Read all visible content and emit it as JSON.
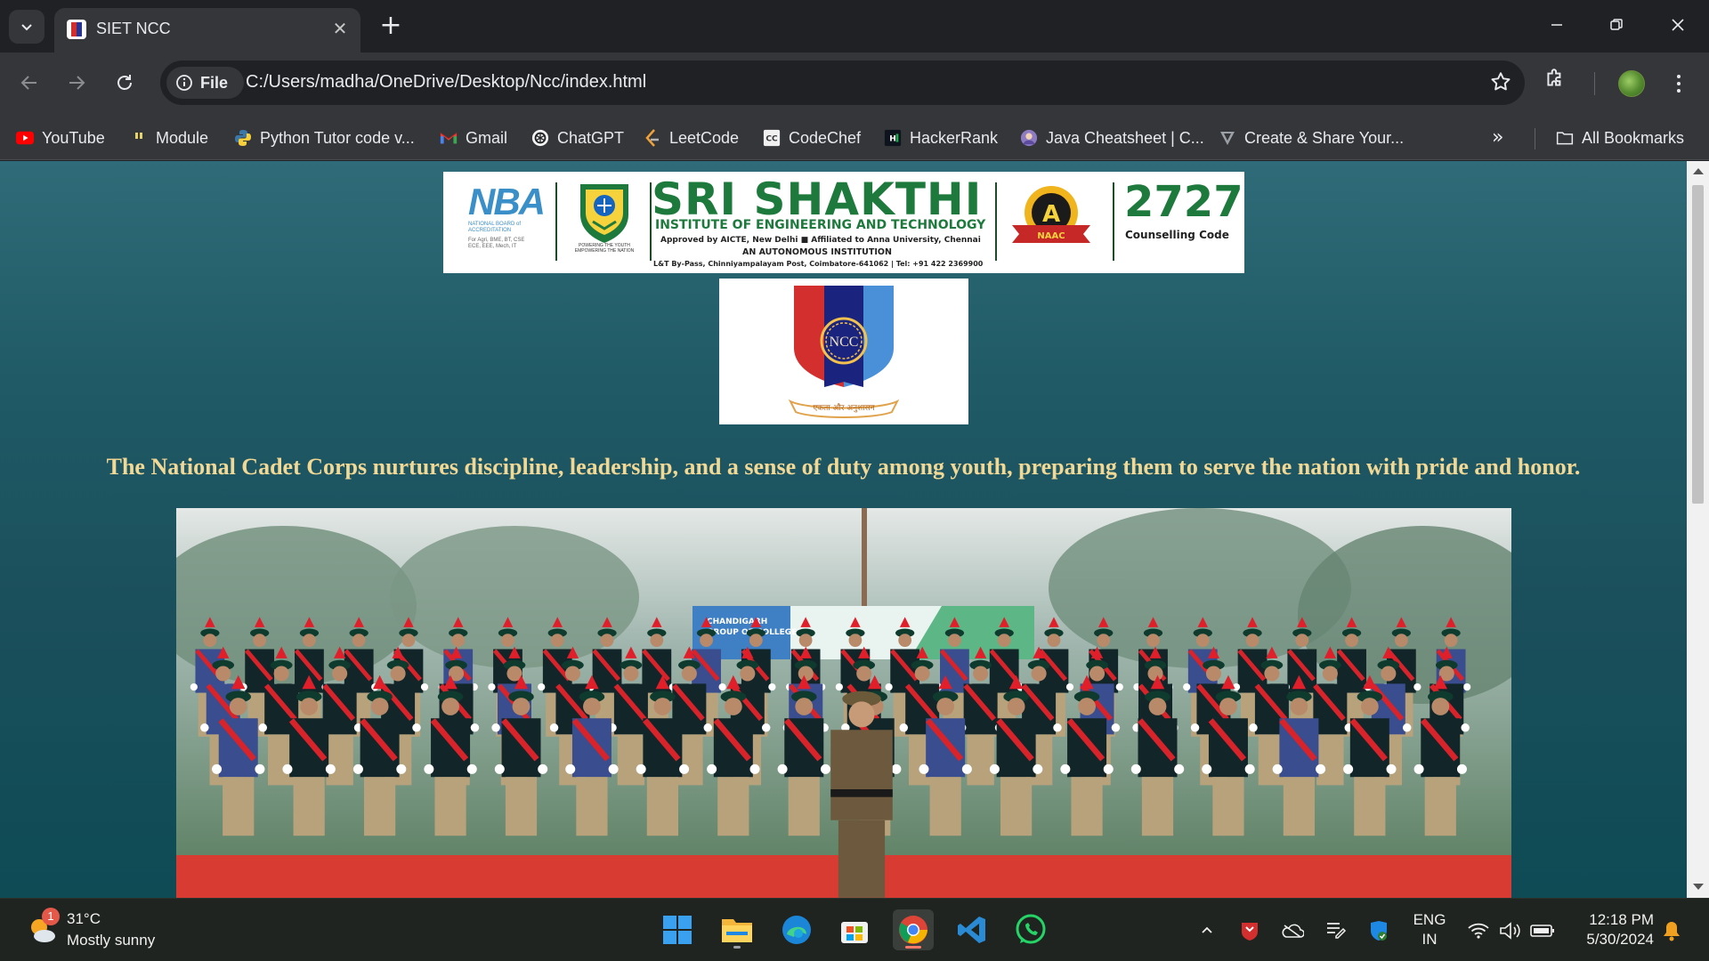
{
  "browser": {
    "tab_title": "SIET NCC",
    "new_tab_symbol": "+",
    "close_symbol": "✕",
    "site_chip": "File",
    "url": "C:/Users/madha/OneDrive/Desktop/Ncc/index.html"
  },
  "bookmarks": {
    "items": [
      {
        "label": "YouTube",
        "icon": "youtube-icon"
      },
      {
        "label": "Module",
        "icon": "module-icon"
      },
      {
        "label": "Python Tutor code v...",
        "icon": "python-icon"
      },
      {
        "label": "Gmail",
        "icon": "gmail-icon"
      },
      {
        "label": "ChatGPT",
        "icon": "chatgpt-icon"
      },
      {
        "label": "LeetCode",
        "icon": "leetcode-icon"
      },
      {
        "label": "CodeChef",
        "icon": "codechef-icon"
      },
      {
        "label": "HackerRank",
        "icon": "hackerrank-icon"
      },
      {
        "label": "Java Cheatsheet | C...",
        "icon": "java-icon"
      },
      {
        "label": "Create & Share Your...",
        "icon": "create-share-icon"
      }
    ],
    "more_symbol": "»",
    "all_bookmarks": "All Bookmarks"
  },
  "page": {
    "banner": {
      "nba_logo": "NBA",
      "nba_caption": "NATIONAL BOARD of ACCREDITATION",
      "nba_programs": "For Agri, BME, BT, CSE ECE, EEE, Mech, IT",
      "crest_caption": "POWERING THE YOUTH EMPOWERING THE NATION",
      "name": "SRI SHAKTHI",
      "subtitle": "INSTITUTE OF ENGINEERING AND TECHNOLOGY",
      "approval": "Approved by AICTE, New Delhi  ■  Affiliated to Anna University, Chennai",
      "autonomous": "AN AUTONOMOUS INSTITUTION",
      "address": "L&T By-Pass, Chinniyampalayam Post, Coimbatore-641062 | Tel: +91 422 2369900",
      "naac_grade": "A",
      "naac_label": "NAAC",
      "counselling_code": "2727",
      "counselling_label": "Counselling Code"
    },
    "ncc_logo_text": "NCC",
    "ncc_motto": "एकता और अनुशासन",
    "tagline": "The National Cadet Corps nurtures discipline, leadership, and a sense of duty among youth, preparing them to serve the nation with pride and honor.",
    "photo_banner_text": "CHANDIGARH GROUP OF COLLEGES"
  },
  "taskbar": {
    "weather_badge": "1",
    "weather_temp": "31°C",
    "weather_desc": "Mostly sunny",
    "apps": [
      "windows-start-icon",
      "file-explorer-icon",
      "edge-icon",
      "store-icon",
      "chrome-icon",
      "vscode-icon",
      "whatsapp-icon"
    ],
    "lang_line1": "ENG",
    "lang_line2": "IN",
    "time": "12:18 PM",
    "date": "5/30/2024"
  },
  "colors": {
    "page_bg": "#1a4f5b",
    "tagline": "#f2d895",
    "brand_green": "#1e7a3c",
    "chrome_dark": "#202124",
    "chrome_toolbar": "#35363a"
  }
}
